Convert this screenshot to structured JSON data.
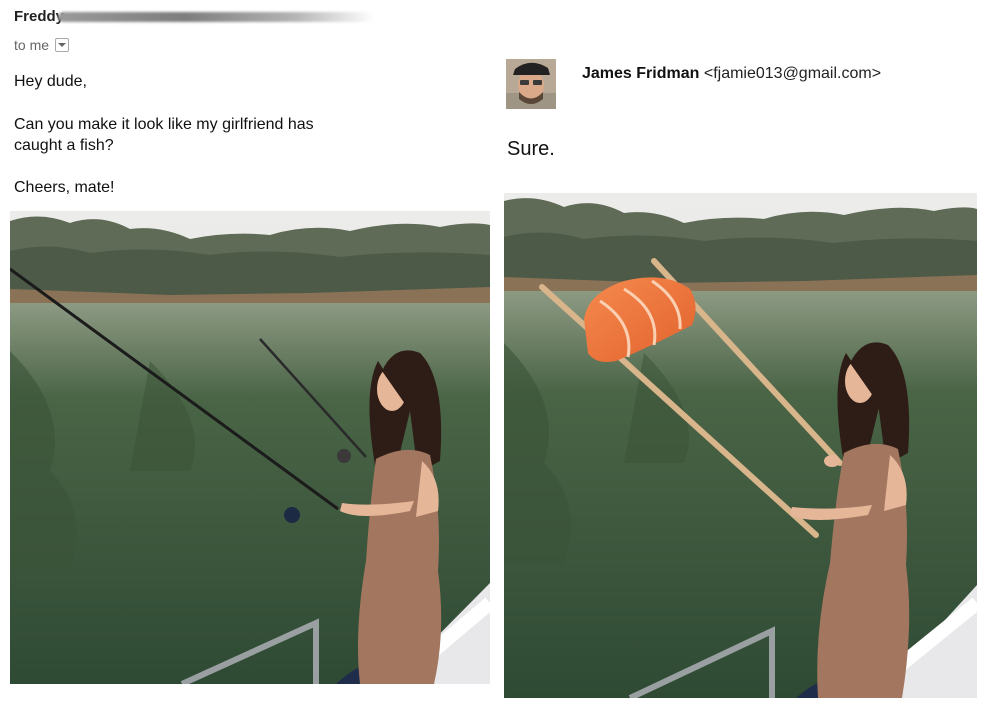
{
  "left_email": {
    "sender_name": "Freddy",
    "recipient_label": "to me",
    "greeting": "Hey dude,",
    "request_line1": "Can you make it look like my girlfriend has",
    "request_line2": "caught a fish?",
    "closing": "Cheers, mate!"
  },
  "right_email": {
    "sender_name": "James Fridman",
    "sender_email": "<fjamie013@gmail.com>",
    "reply": "Sure."
  },
  "colors": {
    "water": "#3c5438",
    "sky": "#eaeae4",
    "trees": "#5e6a55",
    "bank": "#8c7456",
    "dress": "#a37660",
    "hair": "#2e1d16",
    "skin": "#e8b89a",
    "salmon": "#f0773c",
    "chopstick": "#d8b58a"
  }
}
